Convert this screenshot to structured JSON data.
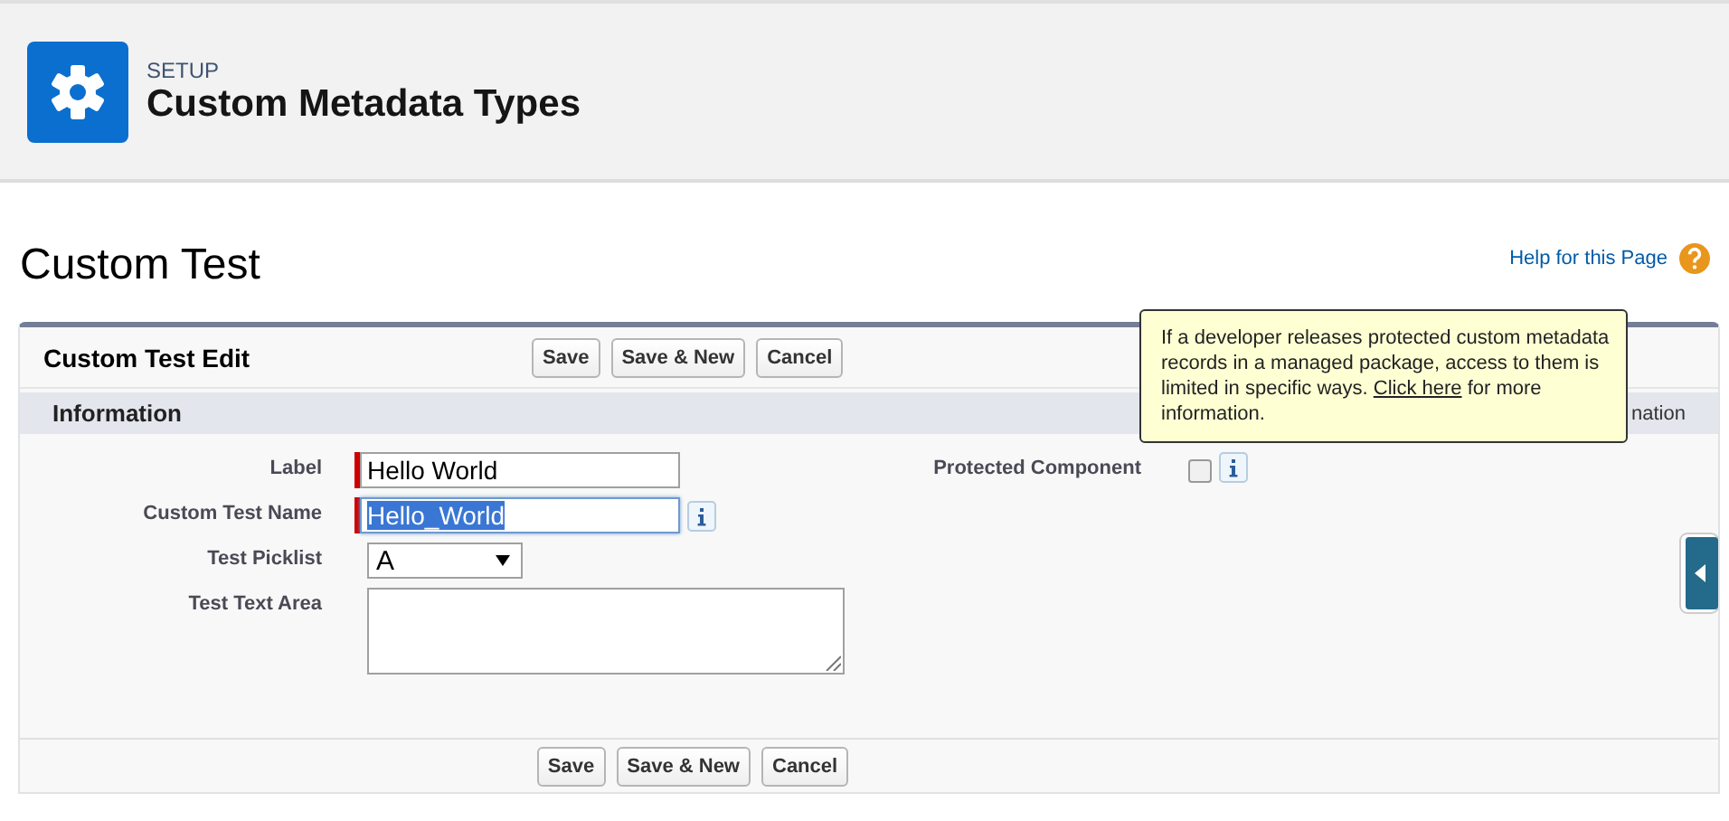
{
  "header": {
    "eyebrow": "SETUP",
    "title": "Custom Metadata Types"
  },
  "page": {
    "title": "Custom Test",
    "help_link": "Help for this Page"
  },
  "panel": {
    "title": "Custom Test Edit",
    "top_buttons": [
      "Save",
      "Save & New",
      "Cancel"
    ],
    "section": "Information",
    "section_note": "nation",
    "bottom_buttons": [
      "Save",
      "Save & New",
      "Cancel"
    ]
  },
  "fields": [
    {
      "kind": "text",
      "label": "Label",
      "value": "Hello World",
      "required": true,
      "info": false,
      "highlighted": false
    },
    {
      "kind": "text",
      "label": "Custom Test Name",
      "value": "Hello_World",
      "required": true,
      "info": true,
      "highlighted": true
    },
    {
      "kind": "picklist",
      "label": "Test Picklist",
      "value": "A",
      "required": false,
      "info": false
    },
    {
      "kind": "textarea",
      "label": "Test Text Area",
      "required": false,
      "info": false
    }
  ],
  "right_fields": [
    {
      "kind": "checkbox",
      "label": "Protected Component",
      "checked": false,
      "info": true
    }
  ],
  "tooltip": {
    "text": "If a developer releases protected custom metadata records in a managed package, access to them is limited in specific ways.",
    "link": "Click here",
    "after": "for more information."
  }
}
